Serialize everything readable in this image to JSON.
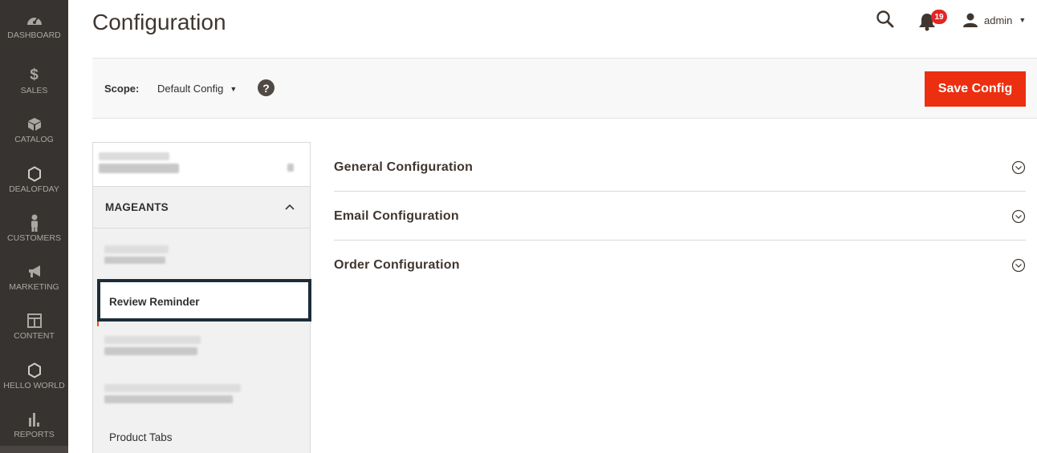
{
  "nav": {
    "items": [
      {
        "label": "DASHBOARD",
        "icon": "dashboard-icon"
      },
      {
        "label": "SALES",
        "icon": "dollar-icon"
      },
      {
        "label": "CATALOG",
        "icon": "box-icon"
      },
      {
        "label": "DEALOFDAY",
        "icon": "hexagon-icon"
      },
      {
        "label": "CUSTOMERS",
        "icon": "person-icon"
      },
      {
        "label": "MARKETING",
        "icon": "megaphone-icon"
      },
      {
        "label": "CONTENT",
        "icon": "layout-icon"
      },
      {
        "label": "HELLO WORLD",
        "icon": "hexagon-icon"
      },
      {
        "label": "REPORTS",
        "icon": "bar-chart-icon"
      }
    ]
  },
  "header": {
    "title": "Configuration",
    "notification_count": "19",
    "user_name": "admin"
  },
  "scope": {
    "label": "Scope:",
    "value": "Default Config",
    "help": "?",
    "save_label": "Save Config"
  },
  "tabs": {
    "section_title": "MAGEANTS",
    "active_tab": "Review Reminder",
    "last_tab": "Product Tabs"
  },
  "sections": [
    {
      "title": "General Configuration"
    },
    {
      "title": "Email Configuration"
    },
    {
      "title": "Order Configuration"
    }
  ],
  "colors": {
    "nav_bg": "#373330",
    "accent": "#eb2f10",
    "active_border": "#1c2c3a",
    "badge": "#e22626"
  }
}
